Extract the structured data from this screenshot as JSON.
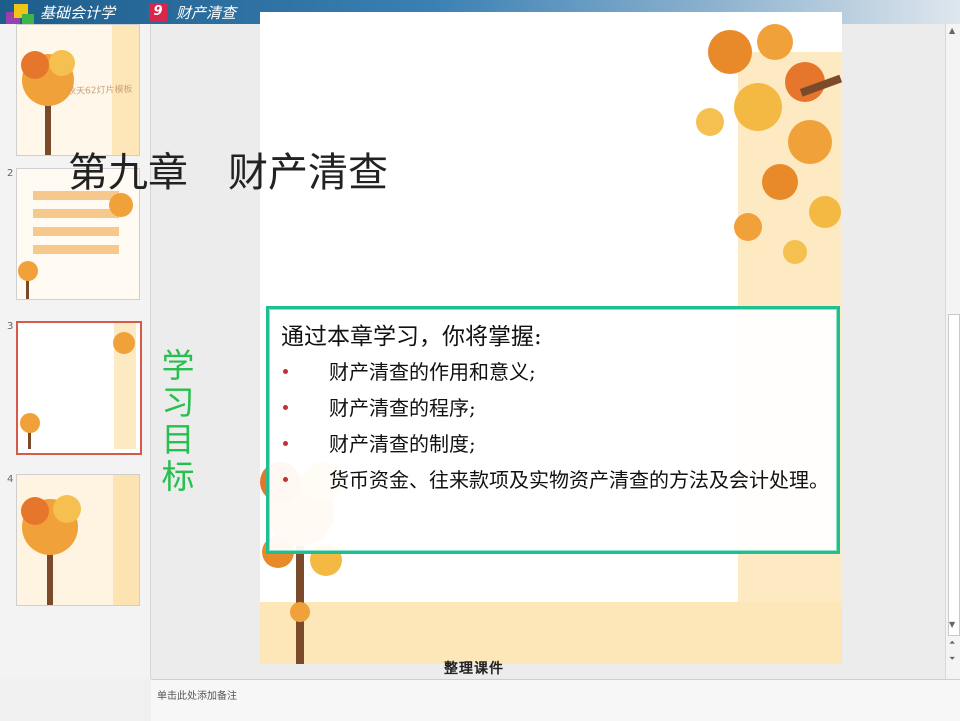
{
  "header": {
    "course": "基础会计学",
    "chapter_number": "9",
    "chapter_title": "财产清查"
  },
  "thumbnails": [
    {
      "number": "",
      "hint": "秋天62灯片模板"
    },
    {
      "number": "2"
    },
    {
      "number": "3"
    },
    {
      "number": "4"
    }
  ],
  "slide": {
    "title": "第九章　财产清查",
    "objective_label": "学习目标",
    "intro": "通过本章学习，你将掌握:",
    "bullets": [
      "财产清查的作用和意义;",
      "财产清查的程序;",
      "财产清查的制度;",
      "货币资金、往来款项及实物资产清查的方法及会计处理。"
    ]
  },
  "footer_text": "整理课件",
  "notes_placeholder": "单击此处添加备注",
  "colors": {
    "accent_green": "#27c04f",
    "box_border": "#1fbf93",
    "bullet": "#c53030",
    "header": "#1d5d8b"
  },
  "icons": [
    "logo-icon",
    "maple-tree-icon",
    "maple-leaf-icon"
  ]
}
